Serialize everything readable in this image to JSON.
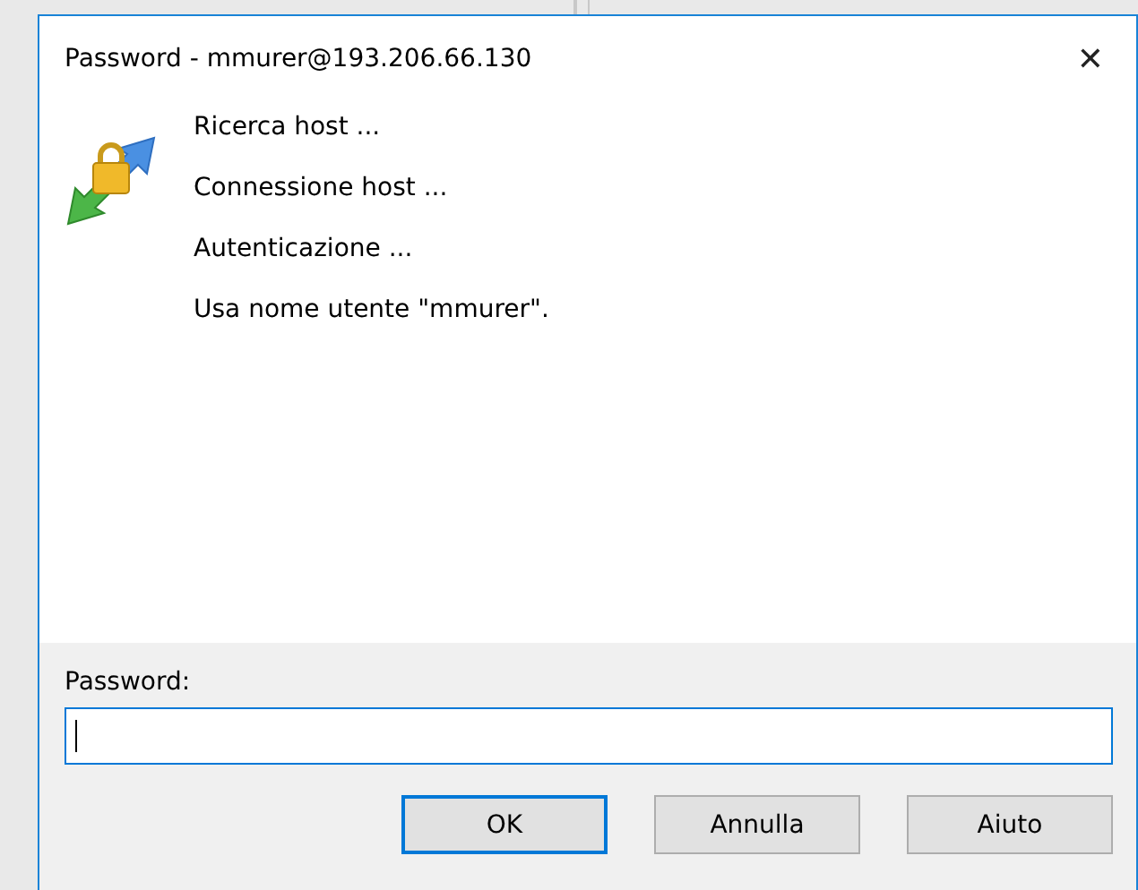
{
  "window": {
    "title": "Password - mmurer@193.206.66.130",
    "close": "✕"
  },
  "messages": [
    "Ricerca host ...",
    "Connessione host ...",
    "Autenticazione ...",
    "Usa nome utente \"mmurer\"."
  ],
  "password_field": {
    "label": "Password:",
    "focused": true
  },
  "buttons": [
    {
      "label": "OK",
      "default": true
    },
    {
      "label": "Annulla",
      "default": false
    },
    {
      "label": "Aiuto",
      "default": false
    }
  ]
}
